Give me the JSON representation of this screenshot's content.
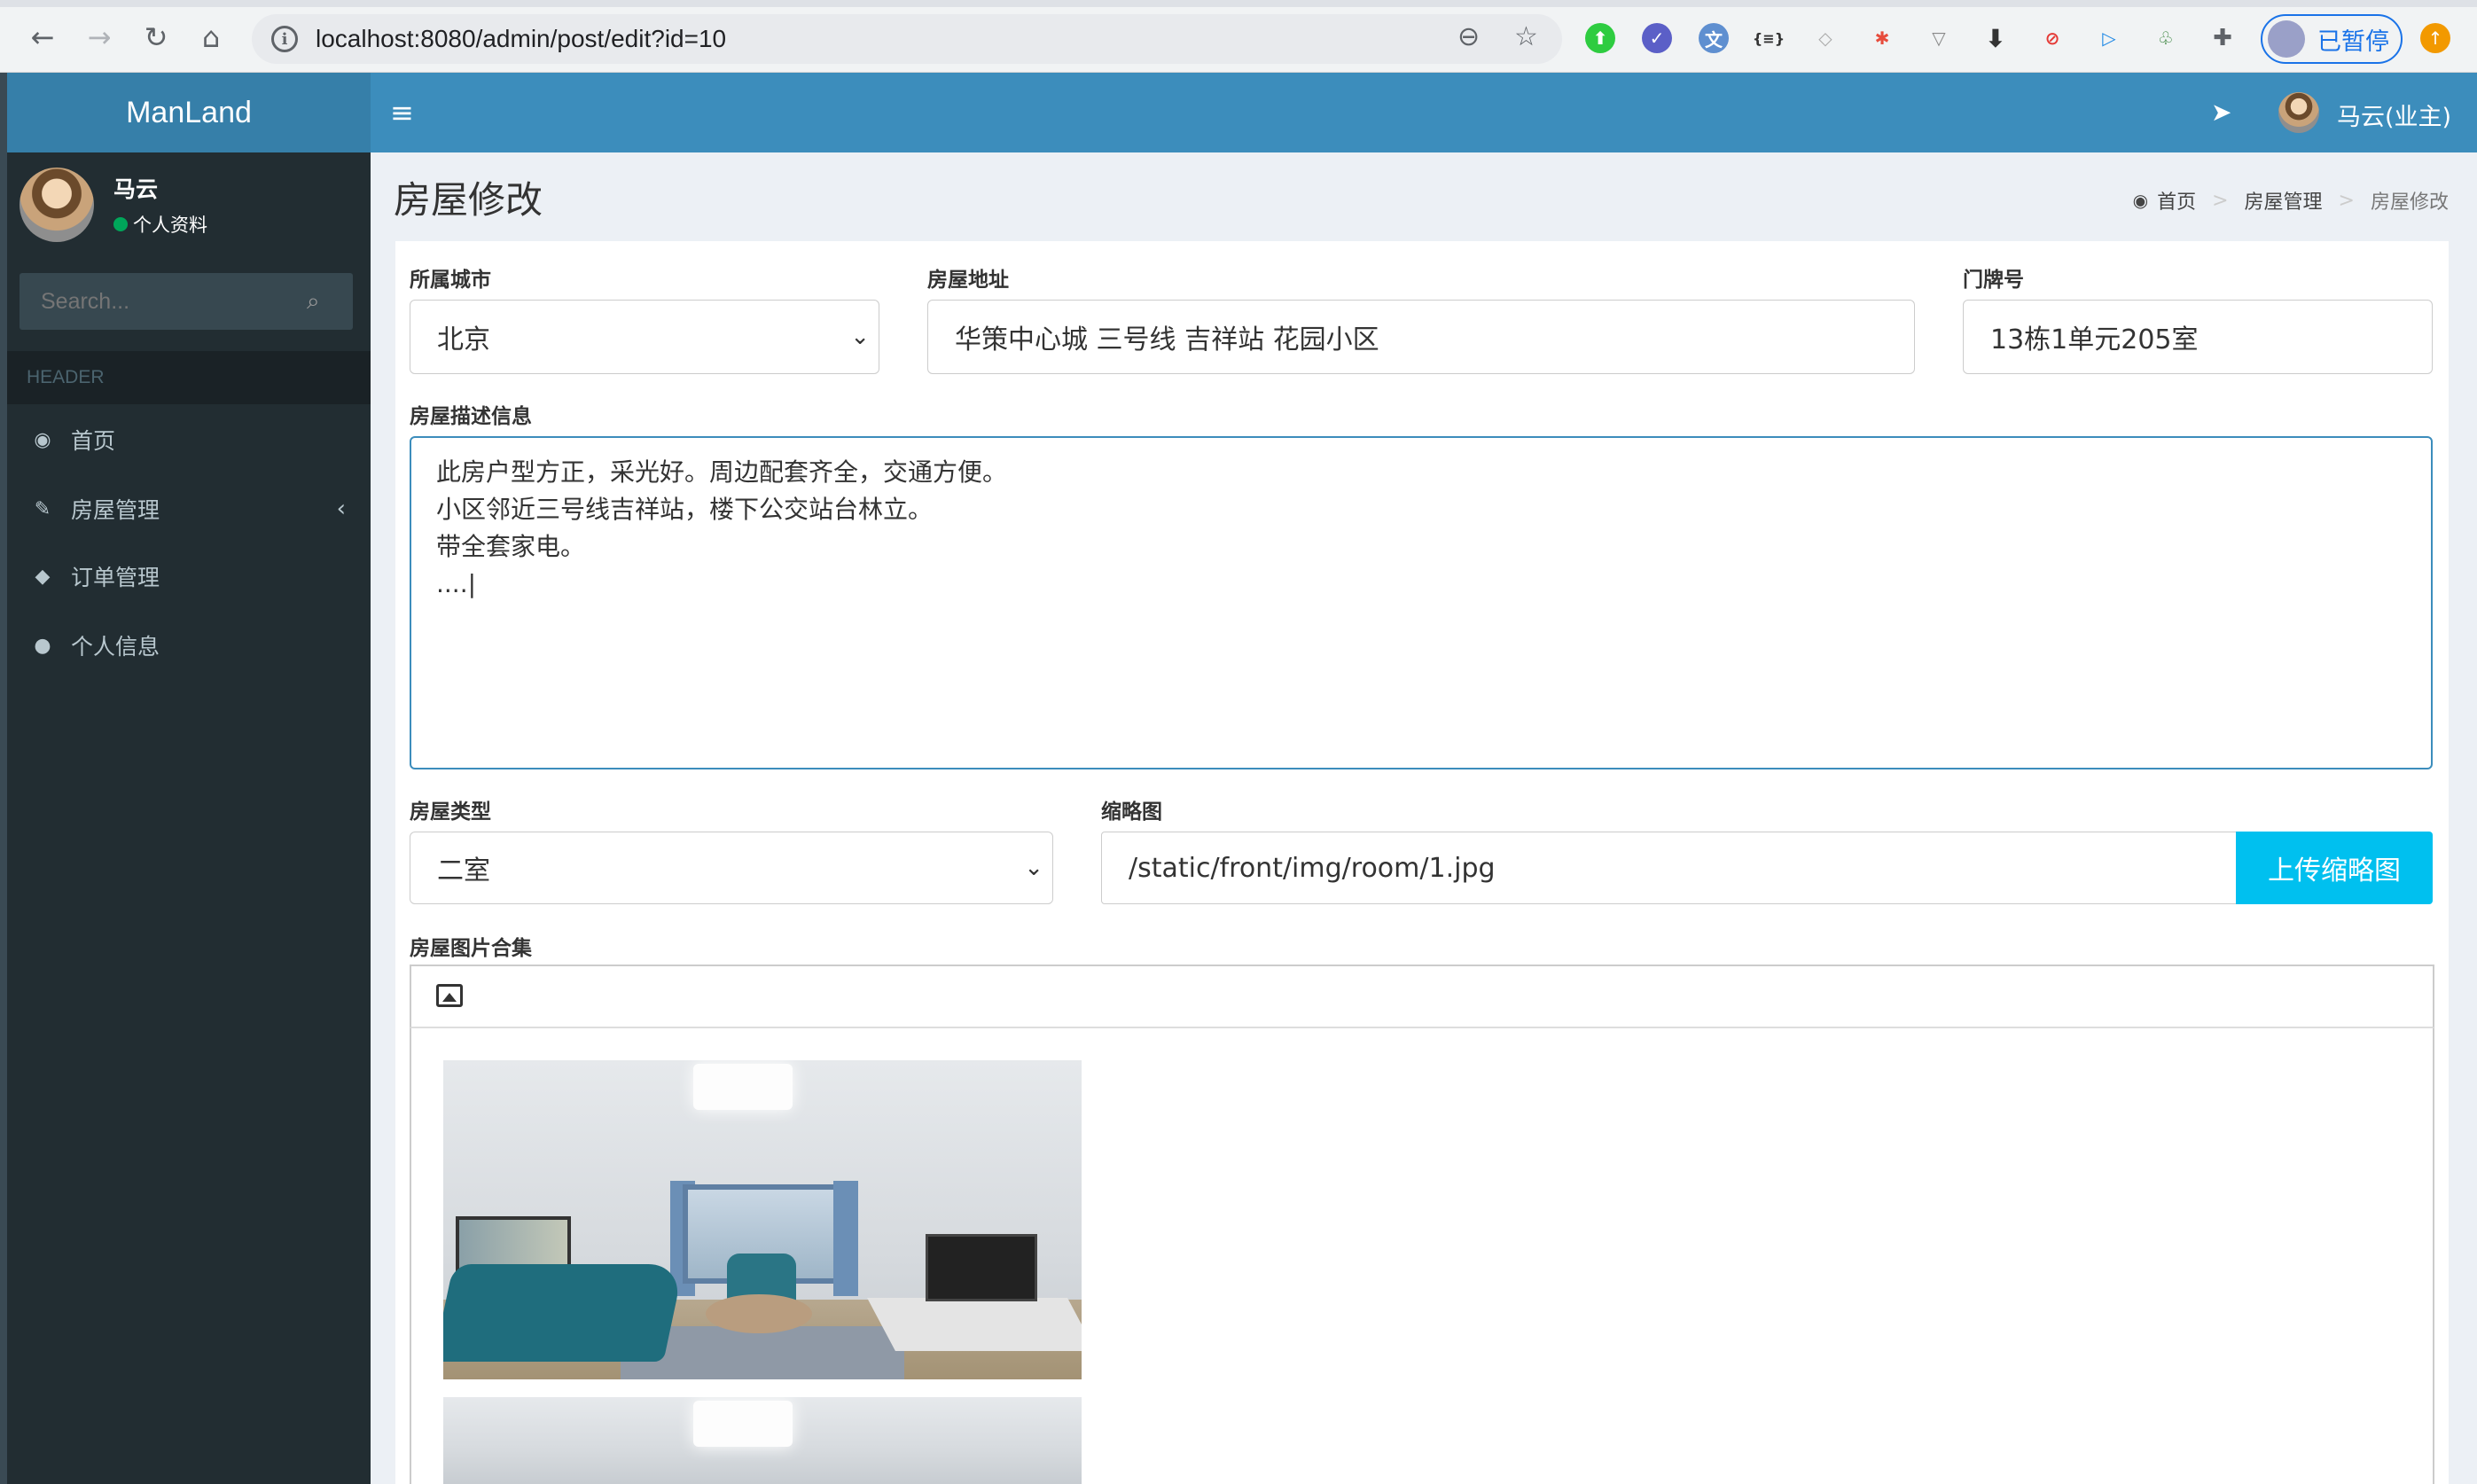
{
  "browser": {
    "url": "localhost:8080/admin/post/edit?id=10",
    "profile_status": "已暂停"
  },
  "sidebar": {
    "brand": "ManLand",
    "user_name": "马云",
    "user_status": "个人资料",
    "search_placeholder": "Search...",
    "header_label": "HEADER",
    "items": [
      {
        "label": "首页",
        "icon": "dashboard-icon"
      },
      {
        "label": "房屋管理",
        "icon": "paint-brush-icon"
      },
      {
        "label": "订单管理",
        "icon": "tag-icon"
      },
      {
        "label": "个人信息",
        "icon": "user-icon"
      }
    ]
  },
  "navbar": {
    "user_label": "马云(业主)"
  },
  "page": {
    "title": "房屋修改",
    "breadcrumb": [
      "首页",
      "房屋管理",
      "房屋修改"
    ]
  },
  "form": {
    "city_label": "所属城市",
    "city_value": "北京",
    "address_label": "房屋地址",
    "address_value": "华策中心城 三号线 吉祥站 花园小区",
    "door_label": "门牌号",
    "door_value": "13栋1单元205室",
    "desc_label": "房屋描述信息",
    "desc_lines": [
      "此房户型方正，采光好。周边配套齐全，交通方便。",
      "小区邻近三号线吉祥站，楼下公交站台林立。",
      "带全套家电。",
      "....|"
    ],
    "type_label": "房屋类型",
    "type_value": "二室",
    "thumb_label": "缩略图",
    "thumb_value": "/static/front/img/room/1.jpg",
    "upload_button": "上传缩略图",
    "gallery_label": "房屋图片合集"
  },
  "colors": {
    "navbar": "#3c8dbc",
    "brand": "#367fa9",
    "sidebar": "#222d32",
    "upload_button": "#00c0ef",
    "status_online": "#00a65a"
  }
}
